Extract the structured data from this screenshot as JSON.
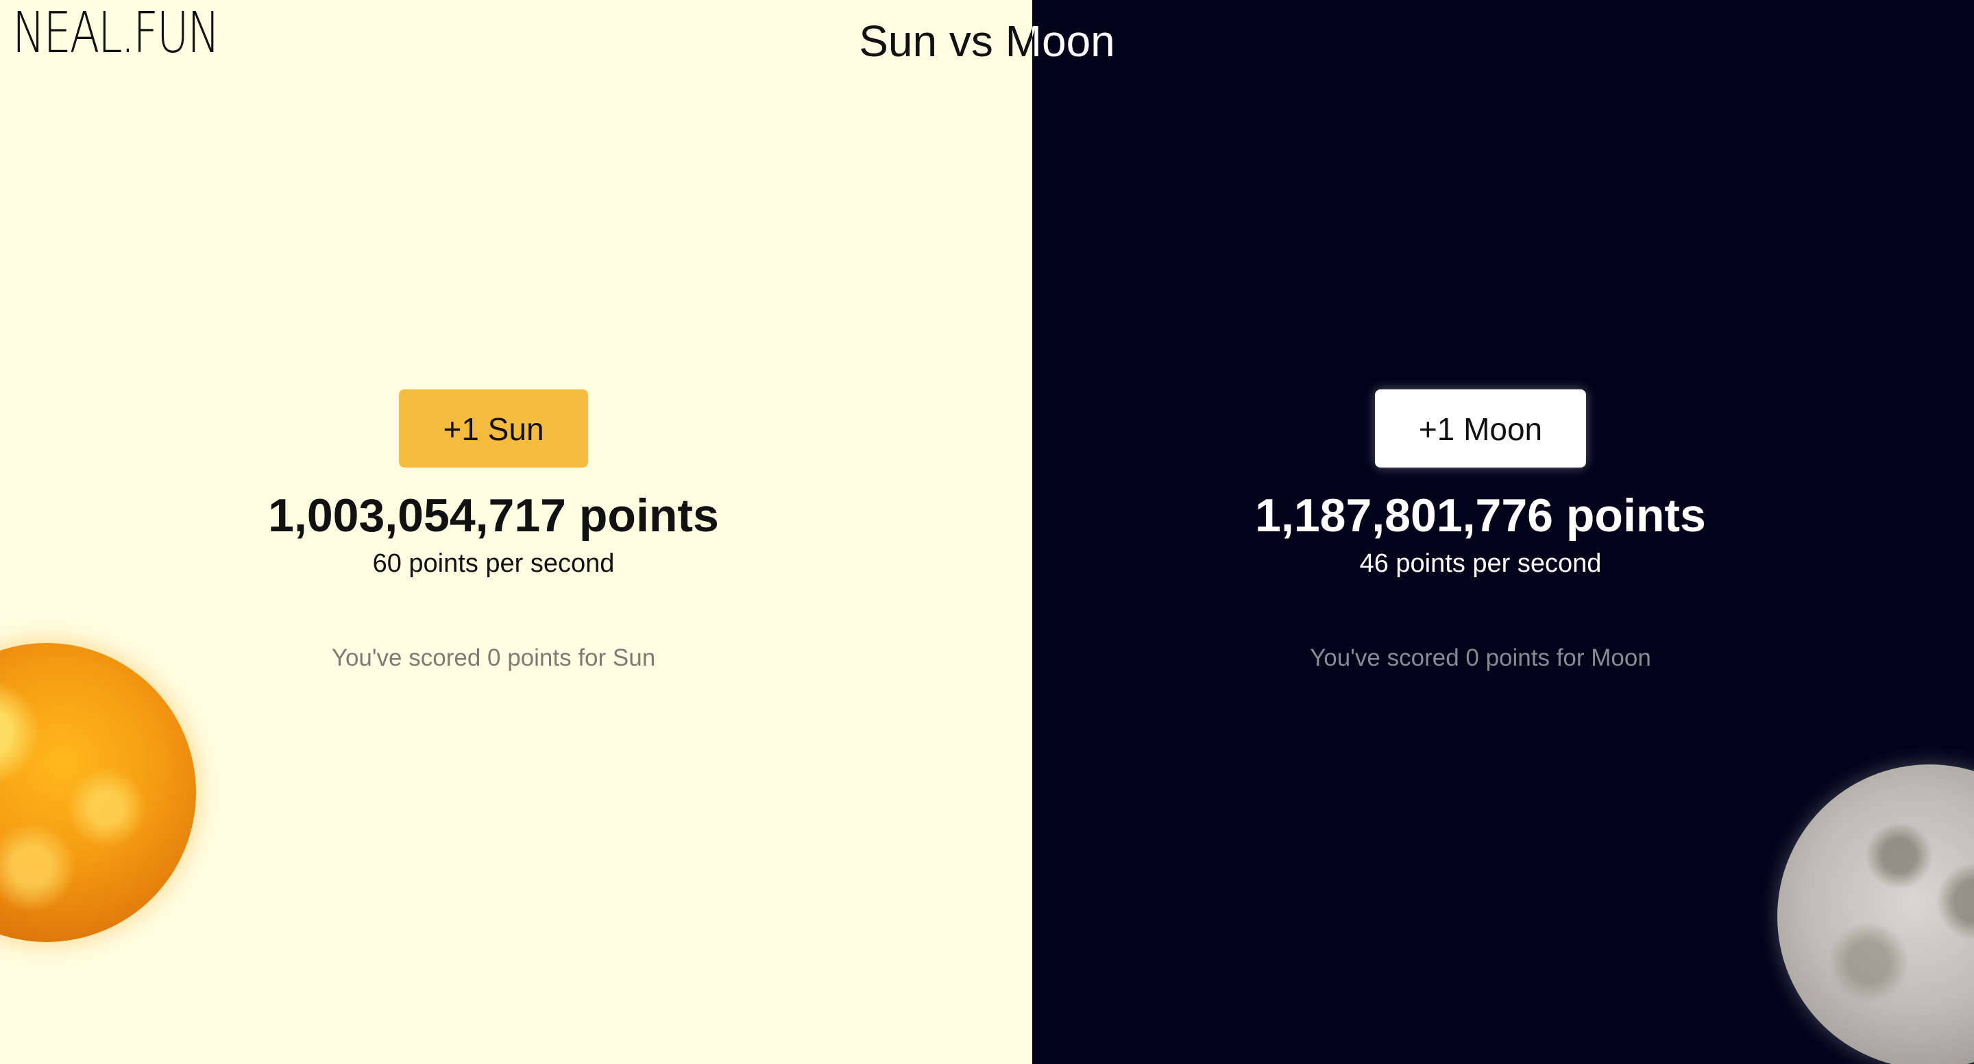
{
  "logo": "NEAL.FUN",
  "title": "Sun vs Moon",
  "sun": {
    "button_label": "+1 Sun",
    "points": "1,003,054,717 points",
    "rate": "60 points per second",
    "scored": "You've scored 0 points for Sun",
    "accent_color": "#f4bb3e",
    "background_color": "#fffee3",
    "icon": "sun-image"
  },
  "moon": {
    "button_label": "+1 Moon",
    "points": "1,187,801,776 points",
    "rate": "46 points per second",
    "scored": "You've scored 0 points for Moon",
    "accent_color": "#ffffff",
    "background_color": "#03021a",
    "icon": "moon-image"
  }
}
